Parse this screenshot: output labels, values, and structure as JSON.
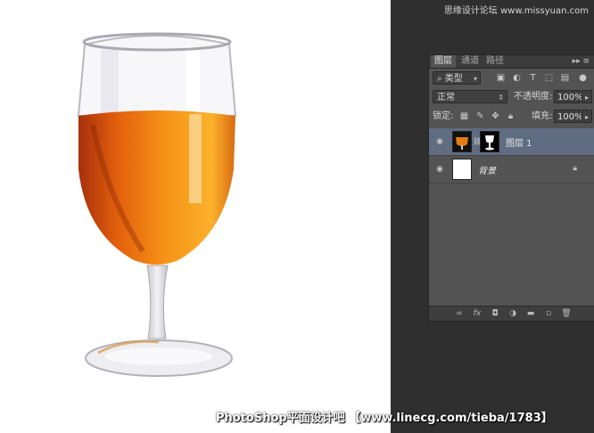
{
  "watermarks": {
    "top": "思缘设计论坛 www.missyuan.com",
    "bottom": "PhotoShop平面设计吧 【www.linecg.com/tieba/1783】"
  },
  "layers_panel": {
    "tabs": [
      "图层",
      "通道",
      "路径"
    ],
    "filter": {
      "label": "类型"
    },
    "blend_mode": "正常",
    "opacity_label": "不透明度:",
    "opacity_value": "100%",
    "lock_label": "锁定:",
    "fill_label": "填充:",
    "fill_value": "100%",
    "layers": [
      {
        "name": "图层 1",
        "selected": true,
        "has_mask": true
      },
      {
        "name": "背景",
        "selected": false,
        "locked": true
      }
    ]
  },
  "colors": {
    "juice_orange": "#f28a10",
    "panel_bg": "#535353",
    "workspace_bg": "#2f2f2f",
    "selected_layer": "#5f6c82"
  }
}
